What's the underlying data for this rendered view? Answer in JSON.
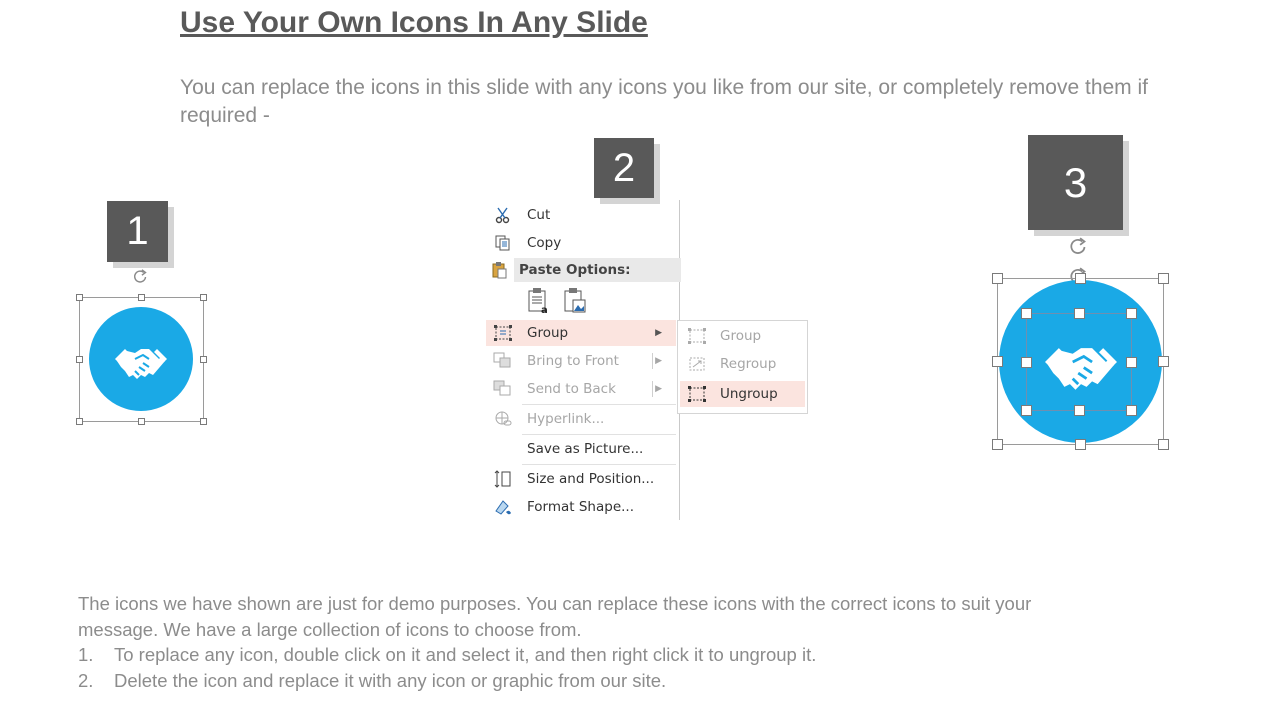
{
  "title": "Use Your Own Icons In Any Slide",
  "subtitle": "You can replace the icons in this slide with any icons you like from our site, or completely remove them if required -",
  "steps": [
    "1",
    "2",
    "3"
  ],
  "icon_color": "#1aa9e6",
  "step_color": "#595959",
  "context_menu": {
    "items": [
      {
        "label": "Cut",
        "icon": "scissors-icon"
      },
      {
        "label": "Copy",
        "icon": "copy-icon"
      },
      {
        "label": "Paste Options:",
        "icon": "clipboard-icon"
      },
      {
        "label": "Group",
        "icon": "group-icon",
        "submenu": true
      },
      {
        "label": "Bring to Front",
        "icon": "bring-to-front-icon",
        "submenu": true,
        "disabled": true
      },
      {
        "label": "Send to Back",
        "icon": "send-to-back-icon",
        "submenu": true,
        "disabled": true
      },
      {
        "label": "Hyperlink...",
        "icon": "hyperlink-icon",
        "disabled": true
      },
      {
        "label": "Save as Picture...",
        "icon": ""
      },
      {
        "label": "Size and Position...",
        "icon": "size-position-icon"
      },
      {
        "label": "Format Shape...",
        "icon": "format-shape-icon"
      }
    ]
  },
  "submenu": {
    "items": [
      {
        "label": "Group",
        "disabled": true
      },
      {
        "label": "Regroup",
        "disabled": true
      },
      {
        "label": "Ungroup",
        "active": true
      }
    ]
  },
  "body": {
    "intro": "The icons we have shown are just for demo purposes. You can replace these icons with the correct icons to suit your message. We have a large collection of icons to choose from.",
    "items": [
      {
        "num": "1.",
        "text": "To replace any icon, double click on it and select it, and then right click it to ungroup it."
      },
      {
        "num": "2.",
        "text": "Delete the icon and replace it with any icon or graphic from our site."
      }
    ]
  }
}
